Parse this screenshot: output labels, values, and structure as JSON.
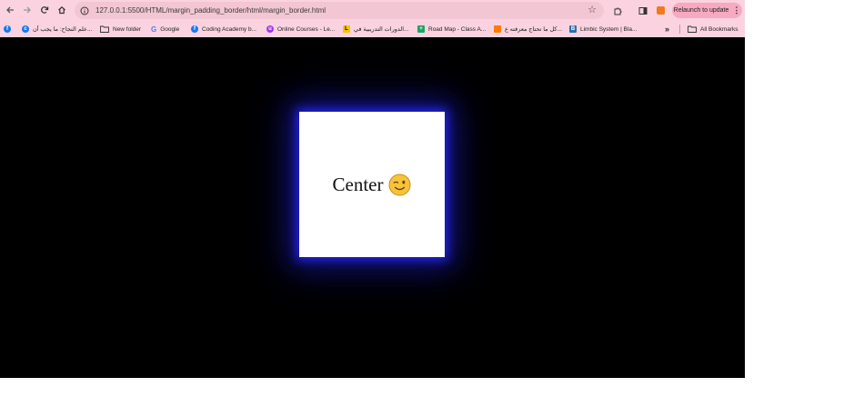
{
  "browser": {
    "url": "127.0.0.1:5500/HTML/margin_padding_border/html/margin_border.html",
    "relaunch_label": "Relaunch to update"
  },
  "bookmarks": {
    "items": [
      {
        "label": "علم النجاح: ما يجب أن...",
        "icon": "facebook-icon",
        "color": "#1877f2"
      },
      {
        "label": "New folder",
        "icon": "folder-icon"
      },
      {
        "label": "Google",
        "icon": "google-icon",
        "color": "#4285f4"
      },
      {
        "label": "Coding Academy b...",
        "icon": "facebook-icon",
        "color": "#1877f2"
      },
      {
        "label": "Online Courses - Le...",
        "icon": "udemy-icon",
        "color": "#a435f0"
      },
      {
        "label": "الدورات التدريبية في...",
        "icon": "bookmark-icon",
        "color": "#f5c400"
      },
      {
        "label": "Road Map - Class A...",
        "icon": "plus-icon",
        "color": "#1ea362"
      },
      {
        "label": "كل ما تحتاج معرفته ع...",
        "icon": "site-icon",
        "color": "#ff7a00"
      },
      {
        "label": "Limbic System | Bla...",
        "icon": "site-icon",
        "color": "#2a6fb0"
      }
    ],
    "all_bookmarks_label": "All Bookmarks"
  },
  "content": {
    "box_text": "Center",
    "box_emoji": "winking-face-emoji"
  },
  "colors": {
    "page_background": "#000000",
    "box_background": "#ffffff",
    "glow": "#2828ff",
    "browser_chrome": "#fbd3e0"
  }
}
